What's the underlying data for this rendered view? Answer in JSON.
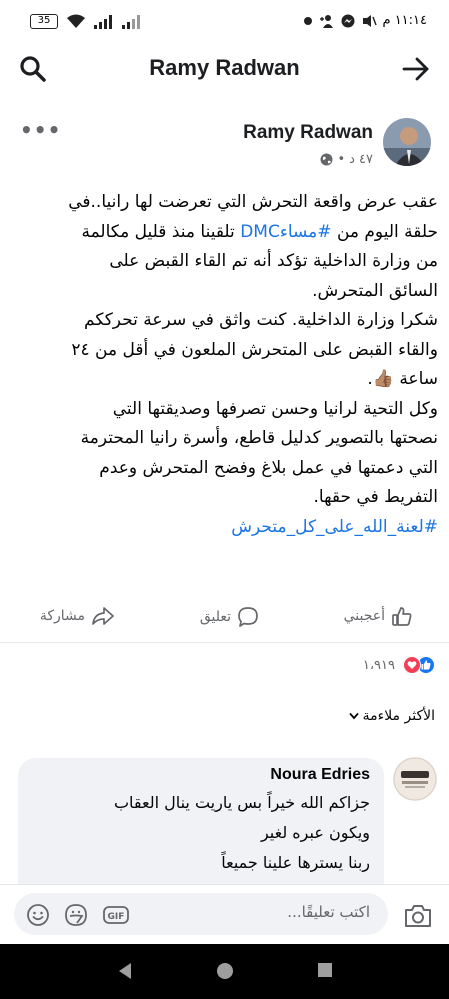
{
  "status_bar": {
    "battery": "35",
    "time": "١١:١٤ م"
  },
  "header": {
    "title": "Ramy Radwan"
  },
  "post": {
    "author": "Ramy Radwan",
    "time": "٤٧ د",
    "body_lines": [
      "عقب عرض واقعة التحرش التي تعرضت لها رانيا..في",
      "حلقة اليوم من ",
      " تلقينا منذ قليل مكالمة",
      "من وزارة الداخلية تؤكد أنه تم القاء القبض على",
      "السائق المتحرش.",
      "شكرا وزارة الداخلية. كنت واثق في سرعة تحرككم",
      "والقاء القبض على المتحرش الملعون في أقل من ٢٤",
      "ساعة",
      "وكل التحية لرانيا وحسن تصرفها وصديقتها التي",
      "نصحتها بالتصوير كدليل قاطع، وأسرة رانيا المحترمة",
      "التي دعمتها في عمل بلاغ وفضح المتحرش وعدم",
      "التفريط في حقها."
    ],
    "hashtag_1": "#مساءDMC",
    "hashtag_2": "#لعنة_الله_على_كل_متحرش",
    "emoji": "👍🏽."
  },
  "actions": {
    "like": "أعجبني",
    "comment": "تعليق",
    "share": "مشاركة"
  },
  "reactions": {
    "count": "١،٩١٩"
  },
  "sort": {
    "label": "الأكثر ملاءمة"
  },
  "comment": {
    "author": "Noura Edries",
    "text_lines": [
      "جزاكم الله خيراً بس ياريت ينال العقاب",
      "ويكون عبره لغير",
      "ربنا يسترها علينا جميعاً"
    ]
  },
  "composer": {
    "placeholder": "اكتب تعليقًا..."
  },
  "colors": {
    "link": "#1b74e4",
    "like_blue": "#1877f2",
    "love_red": "#f33e58",
    "comment_bg": "#f0f2f5"
  }
}
